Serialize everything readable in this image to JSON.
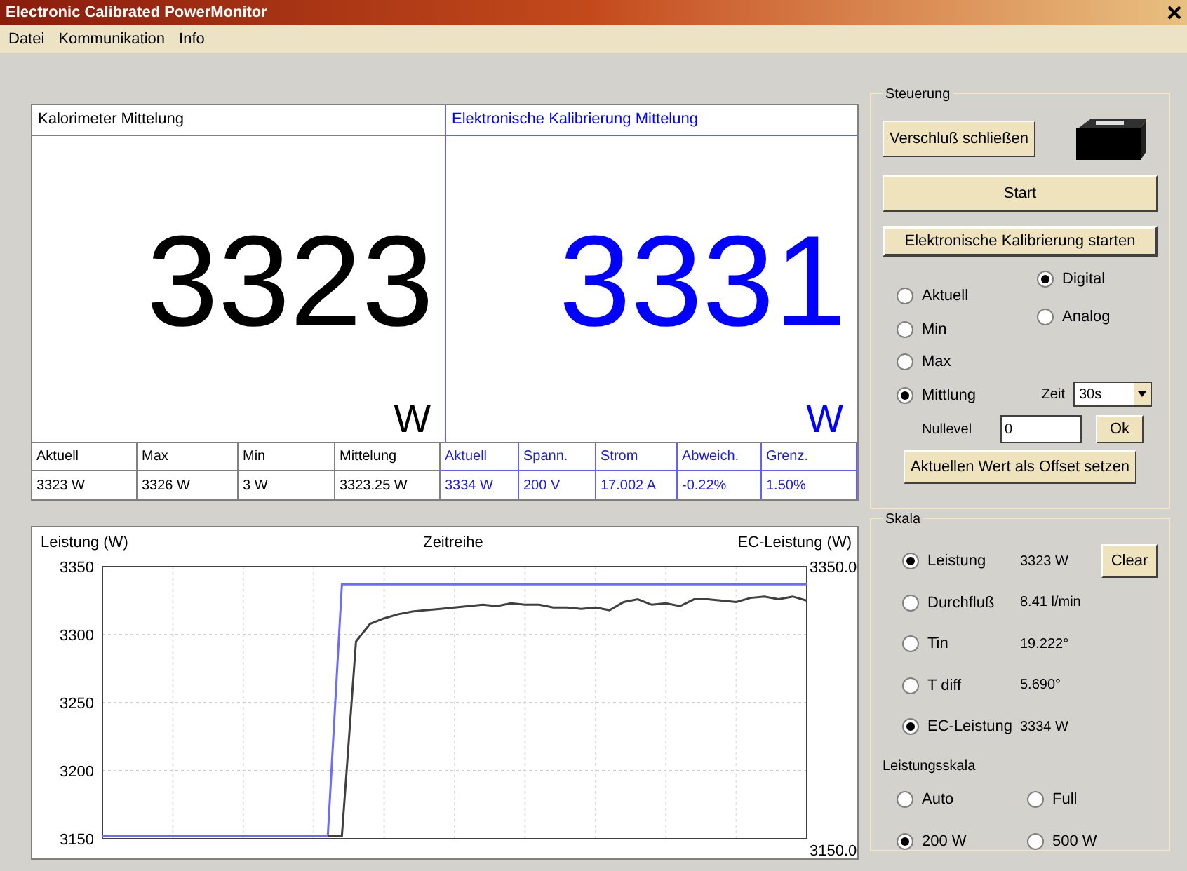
{
  "window": {
    "title": "Electronic Calibrated PowerMonitor"
  },
  "menu": [
    "Datei",
    "Kommunikation",
    "Info"
  ],
  "displays": [
    {
      "title": "Kalorimeter Mittelung",
      "value": "3323",
      "unit": "W",
      "color": "#000000"
    },
    {
      "title": "Elektronische Kalibrierung Mittelung",
      "value": "3331",
      "unit": "W",
      "color": "#0000ff"
    }
  ],
  "table": {
    "columns": [
      {
        "label": "Aktuell",
        "value": "3323 W",
        "kind": "calorimeter"
      },
      {
        "label": "Max",
        "value": "3326 W",
        "kind": "calorimeter"
      },
      {
        "label": "Min",
        "value": "3 W",
        "kind": "calorimeter"
      },
      {
        "label": "Mittelung",
        "value": "3323.25 W",
        "kind": "calorimeter"
      },
      {
        "label": "Aktuell",
        "value": "3334 W",
        "kind": "ec"
      },
      {
        "label": "Spann.",
        "value": "200 V",
        "kind": "ec"
      },
      {
        "label": "Strom",
        "value": "17.002 A",
        "kind": "ec"
      },
      {
        "label": "Abweich.",
        "value": "-0.22%",
        "kind": "ec"
      },
      {
        "label": "Grenz.",
        "value": "1.50%",
        "kind": "ec"
      }
    ]
  },
  "chart": {
    "right_label": "EC-Leistung (W)",
    "right_ticks": [
      "3350.0",
      "3150.0"
    ],
    "chart_data": {
      "type": "line",
      "title": "Zeitreihe",
      "grid": true,
      "ylabel": "Leistung (W)",
      "ylim": [
        3150,
        3350
      ],
      "yticks": [
        3150,
        3200,
        3250,
        3300,
        3350
      ],
      "categories": [
        null,
        null,
        null,
        null,
        null,
        null,
        null,
        null,
        null,
        null,
        null,
        null,
        null,
        null,
        null,
        null,
        null,
        null,
        null,
        null,
        null,
        null,
        null,
        null,
        null,
        null,
        null,
        null,
        null,
        null,
        null,
        null,
        null,
        null,
        null,
        null,
        null,
        null,
        null,
        null,
        null,
        null,
        null,
        null,
        null,
        null,
        null,
        null,
        null,
        null,
        null
      ],
      "series": [
        {
          "color": "#6b6bff",
          "values": [
            3152,
            3152,
            3152,
            3152,
            3152,
            3152,
            3152,
            3152,
            3152,
            3152,
            3152,
            3152,
            3152,
            3152,
            3152,
            3152,
            3152,
            3337,
            3337,
            3337,
            3337,
            3337,
            3337,
            3337,
            3337,
            3337,
            3337,
            3337,
            3337,
            3337,
            3337,
            3337,
            3337,
            3337,
            3337,
            3337,
            3337,
            3337,
            3337,
            3337,
            3337,
            3337,
            3337,
            3337,
            3337,
            3337,
            3337,
            3337,
            3337,
            3337,
            3337
          ]
        },
        {
          "color": "#404040",
          "values": [
            null,
            null,
            null,
            null,
            null,
            null,
            null,
            null,
            null,
            null,
            null,
            null,
            null,
            null,
            null,
            null,
            3152,
            3152,
            3295,
            3308,
            3312,
            3315,
            3317,
            3318,
            3319,
            3320,
            3321,
            3322,
            3321,
            3323,
            3322,
            3322,
            3320,
            3320,
            3319,
            3320,
            3318,
            3324,
            3326,
            3322,
            3323,
            3321,
            3326,
            3326,
            3325,
            3324,
            3327,
            3328,
            3326,
            3328,
            3325
          ]
        }
      ]
    }
  },
  "steuerung": {
    "title": "Steuerung",
    "shutter_button": "Verschluß schließen",
    "start_button": "Start",
    "calibrate_button": "Elektronische Kalibrierung starten",
    "modes": [
      {
        "label": "Aktuell",
        "selected": false
      },
      {
        "label": "Min",
        "selected": false
      },
      {
        "label": "Max",
        "selected": false
      },
      {
        "label": "Mittlung",
        "selected": true
      }
    ],
    "display_types": [
      {
        "label": "Digital",
        "selected": true
      },
      {
        "label": "Analog",
        "selected": false
      }
    ],
    "zeit": {
      "label": "Zeit",
      "value": "30s"
    },
    "nullevel": {
      "label": "Nullevel",
      "value": "0",
      "button": "Ok"
    },
    "offset_button": "Aktuellen Wert als Offset setzen"
  },
  "skala": {
    "title": "Skala",
    "clear_button": "Clear",
    "signals": [
      {
        "label": "Leistung",
        "value": "3323 W",
        "checked": true
      },
      {
        "label": "Durchfluß",
        "value": "8.41 l/min",
        "checked": false
      },
      {
        "label": "Tin",
        "value": "19.222°",
        "checked": false
      },
      {
        "label": "T diff",
        "value": "5.690°",
        "checked": false
      },
      {
        "label": "EC-Leistung",
        "value": "3334 W",
        "checked": true
      }
    ],
    "range_title": "Leistungsskala",
    "ranges": [
      {
        "label": "Auto",
        "selected": false
      },
      {
        "label": "Full",
        "selected": false
      },
      {
        "label": "200 W",
        "selected": true
      },
      {
        "label": "500 W",
        "selected": false
      }
    ]
  }
}
